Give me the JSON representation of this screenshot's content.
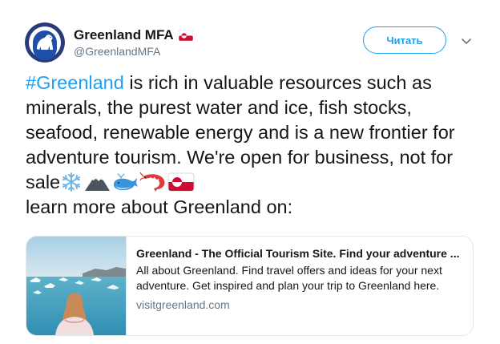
{
  "author": {
    "name": "Greenland MFA",
    "handle": "@GreenlandMFA",
    "flag_icon": "greenland-flag-icon",
    "avatar_icon": "polar-bear-coat-of-arms-icon"
  },
  "follow_button": {
    "label": "Читать"
  },
  "menu": {
    "caret_icon": "chevron-down-icon"
  },
  "tweet": {
    "hashtag": "#Greenland",
    "text_main": " is rich in valuable resources such as minerals, the purest water and ice, fish stocks, seafood, renewable energy and is a new frontier for adventure tourism. We're open for business, not for sale",
    "emojis": [
      "snowflake-icon",
      "mountain-icon",
      "whale-icon",
      "shrimp-icon",
      "greenland-flag-icon"
    ],
    "text_end": "learn more about Greenland on:"
  },
  "card": {
    "title": "Greenland - The Official Tourism Site. Find your adventure ...",
    "description": "All about Greenland. Find travel offers and ideas for your next adventure. Get inspired and plan your trip to Greenland here.",
    "domain": "visitgreenland.com"
  },
  "colors": {
    "accent": "#1da1f2",
    "text": "#14171a",
    "secondary": "#657786",
    "border": "#e1e8ed",
    "flag_red": "#d00c33"
  }
}
